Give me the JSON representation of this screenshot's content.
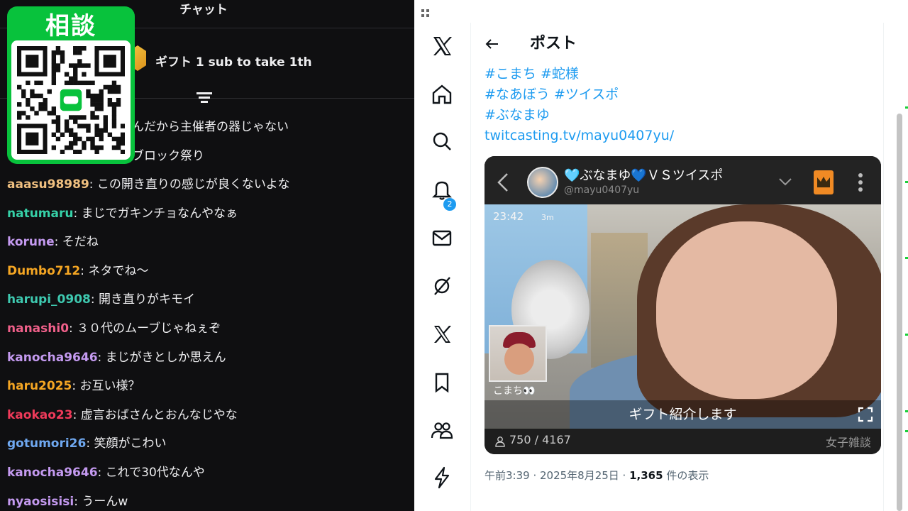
{
  "chat": {
    "title": "チャット",
    "gift_banner": "ギフト 1 sub to take 1th",
    "partial_lines": [
      {
        "text": "んだから主催者の器じゃない",
        "color": "#efeff1"
      },
      {
        "text": "ブロック祭り",
        "color": "#efeff1"
      }
    ],
    "messages": [
      {
        "user": "aaasu98989",
        "text": ": この開き直りの感じが良くないよな",
        "color": "#f0c080"
      },
      {
        "user": "natumaru",
        "text": ": まじでガキンチョなんやなぁ",
        "color": "#36d1a8"
      },
      {
        "user": "korune",
        "text": ": そだね",
        "color": "#c49af0"
      },
      {
        "user": "Dumbo712",
        "text": ": ネタでね〜",
        "color": "#f5a623"
      },
      {
        "user": "harupi_0908",
        "text": ": 開き直りがキモイ",
        "color": "#3ec9b0"
      },
      {
        "user": "nanashi0",
        "text": ": ３０代のムーブじゃねぇぞ",
        "color": "#f0608a"
      },
      {
        "user": "kanocha9646",
        "text": ": まじがきとしか思えん",
        "color": "#c49af0"
      },
      {
        "user": "haru2025",
        "text": ": お互い様？",
        "color": "#f5a623"
      },
      {
        "user": "kaokao23",
        "text": ": 虚言おばさんとおんなじやな",
        "color": "#f03a5a"
      },
      {
        "user": "gotumori26",
        "text": ": 笑顔がこわい",
        "color": "#6fa8f0"
      },
      {
        "user": "kanocha9646",
        "text": ": これで30代なんや",
        "color": "#c49af0"
      },
      {
        "user": "nyaosisisi",
        "text": ": うーんw",
        "color": "#c49af0"
      }
    ]
  },
  "qr": {
    "title": "相談",
    "accent": "#08c23c"
  },
  "x": {
    "sidebar": [
      "x-logo-icon",
      "home-icon",
      "search-icon",
      "notifications-icon",
      "messages-icon",
      "grok-icon",
      "premium-icon",
      "bookmarks-icon",
      "communities-icon",
      "verified-orgs-icon"
    ],
    "notif_count": "2",
    "post_title": "ポスト",
    "hashtag_lines": [
      "#こまち #蛇様",
      "#なあぼう #ツイスポ",
      "#ぶなまゆ"
    ],
    "link": "twitcasting.tv/mayu0407yu/",
    "media": {
      "name": "🩵ぶなまゆ💙ＶＳツイスポ",
      "handle": "@mayu0407yu",
      "time": "23:42",
      "small_label": "3m",
      "pip_label": "こまち👀",
      "caption": "ギフト紹介します",
      "viewers": "750 / 4167",
      "category": "女子雑談"
    },
    "meta_prefix": "午前3:39 · 2025年8月25日 · ",
    "meta_views": "1,365",
    "meta_suffix": " 件の表示",
    "link_color": "#1d9bf0"
  }
}
